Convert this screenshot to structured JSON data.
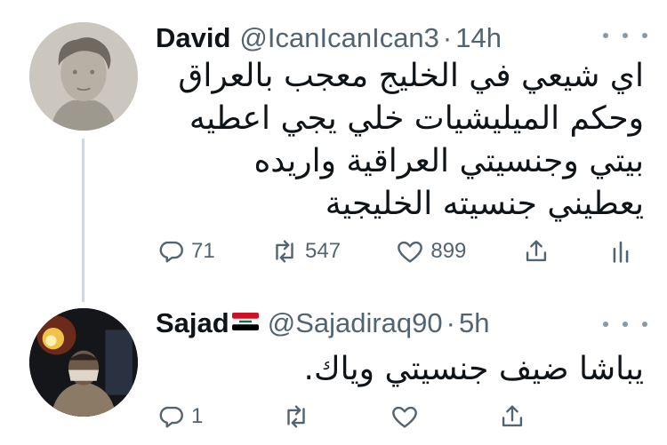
{
  "tweets": [
    {
      "name": "David",
      "handle": "@IcanIcanIcan3",
      "separator": "·",
      "time": "14h",
      "text": "اي شيعي في الخليج معجب بالعراق وحكم الميليشيات خلي يجي اعطيه بيتي وجنسيتي العراقية واريده يعطيني جنسيته الخليجية",
      "replies": "71",
      "retweets": "547",
      "likes": "899"
    },
    {
      "name": "Sajad",
      "handle": "@Sajadiraq90",
      "separator": "·",
      "time": "5h",
      "text": "يباشا ضيف جنسيتي وياك.",
      "replies": "1",
      "retweets": "",
      "likes": ""
    }
  ],
  "colors": {
    "muted": "#536471",
    "text": "#0f1419",
    "thread_line": "#cfd9de"
  },
  "icons": [
    "reply-icon",
    "retweet-icon",
    "like-icon",
    "share-icon",
    "analytics-icon",
    "more-icon",
    "iraq-flag"
  ]
}
